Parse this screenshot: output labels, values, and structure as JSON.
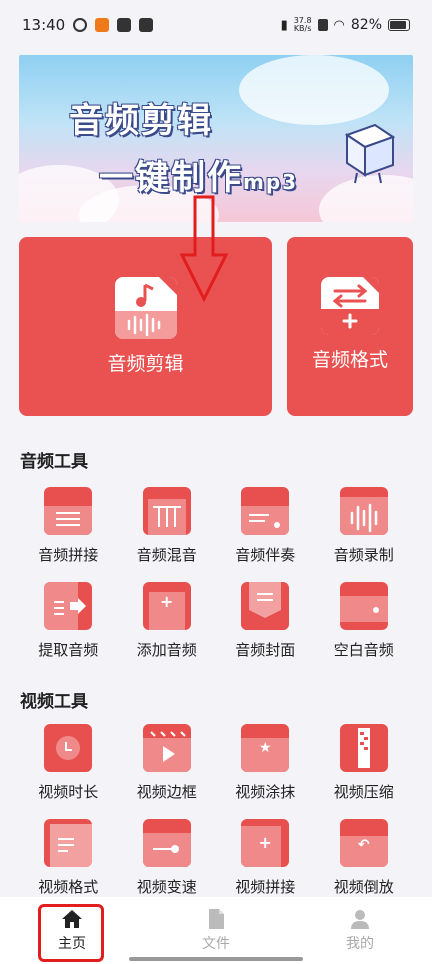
{
  "status": {
    "time": "13:40",
    "speed_value": "37.8",
    "speed_unit": "KB/s",
    "battery": "82%"
  },
  "banner": {
    "line1": "音频剪辑",
    "line2": "一键制作",
    "line2_suffix": "mp3"
  },
  "cards": [
    {
      "label": "音频剪辑"
    },
    {
      "label": "音频格式"
    }
  ],
  "audio_tools": {
    "title": "音频工具",
    "items": [
      {
        "label": "音频拼接",
        "icon": "folder-list-icon"
      },
      {
        "label": "音频混音",
        "icon": "mix-bars-icon"
      },
      {
        "label": "音频伴奏",
        "icon": "document-slider-icon"
      },
      {
        "label": "音频录制",
        "icon": "waveform-icon"
      },
      {
        "label": "提取音频",
        "icon": "extract-icon"
      },
      {
        "label": "添加音频",
        "icon": "add-audio-icon"
      },
      {
        "label": "音频封面",
        "icon": "envelope-cover-icon"
      },
      {
        "label": "空白音频",
        "icon": "blank-card-icon"
      }
    ]
  },
  "video_tools": {
    "title": "视频工具",
    "items": [
      {
        "label": "视频时长",
        "icon": "clock-icon"
      },
      {
        "label": "视频边框",
        "icon": "clapper-icon"
      },
      {
        "label": "视频涂抹",
        "icon": "star-folder-icon"
      },
      {
        "label": "视频压缩",
        "icon": "zip-icon"
      },
      {
        "label": "视频格式",
        "icon": "format-doc-icon"
      },
      {
        "label": "视频变速",
        "icon": "speed-folder-icon"
      },
      {
        "label": "视频拼接",
        "icon": "plus-stack-icon"
      },
      {
        "label": "视频倒放",
        "icon": "rewind-icon"
      }
    ]
  },
  "tabs": [
    {
      "label": "主页",
      "icon": "home-icon",
      "active": true
    },
    {
      "label": "文件",
      "icon": "file-icon",
      "active": false
    },
    {
      "label": "我的",
      "icon": "person-icon",
      "active": false
    }
  ],
  "colors": {
    "accent": "#ea5252",
    "accent_light": "#f08a8a",
    "background": "#f3f3f8",
    "highlight": "#e21d1d"
  }
}
